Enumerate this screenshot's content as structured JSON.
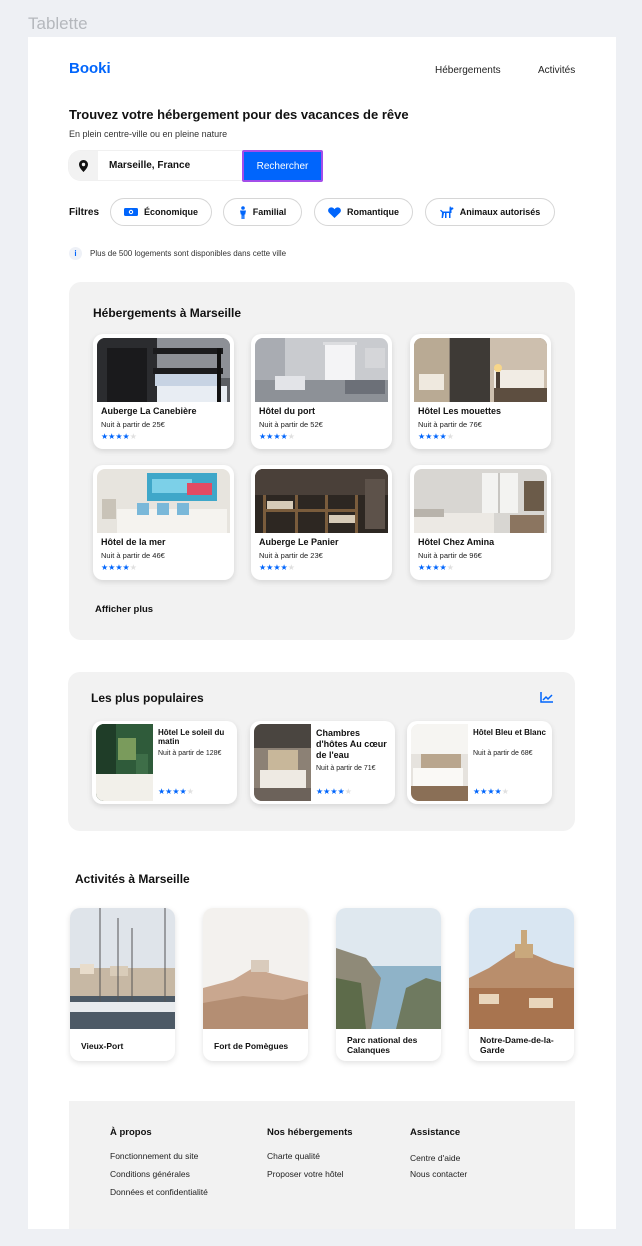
{
  "frame_label": "Tablette",
  "brand": {
    "logo": "Booki",
    "accent": "#0065fc"
  },
  "nav": {
    "items": [
      "Hébergements",
      "Activités"
    ]
  },
  "hero": {
    "title": "Trouvez votre hébergement pour des vacances de rêve",
    "subtitle": "En plein centre-ville ou en pleine nature",
    "search_value": "Marseille, France",
    "search_button": "Rechercher"
  },
  "filters": {
    "label": "Filtres",
    "items": [
      {
        "label": "Économique",
        "icon": "money-icon"
      },
      {
        "label": "Familial",
        "icon": "person-icon"
      },
      {
        "label": "Romantique",
        "icon": "heart-icon"
      },
      {
        "label": "Animaux autorisés",
        "icon": "dog-icon"
      }
    ]
  },
  "info": {
    "icon": "info-icon",
    "text": "Plus de 500 logements sont disponibles dans cette ville"
  },
  "hebergements": {
    "title": "Hébergements à Marseille",
    "more": "Afficher plus",
    "cards": [
      {
        "name": "Auberge La Canebière",
        "price": "Nuit à partir de 25€",
        "rating": 4
      },
      {
        "name": "Hôtel du port",
        "price": "Nuit à partir de 52€",
        "rating": 4
      },
      {
        "name": "Hôtel Les mouettes",
        "price": "Nuit à partir de 76€",
        "rating": 4
      },
      {
        "name": "Hôtel de la mer",
        "price": "Nuit à partir de 46€",
        "rating": 4
      },
      {
        "name": "Auberge Le Panier",
        "price": "Nuit à partir de 23€",
        "rating": 4
      },
      {
        "name": "Hôtel Chez Amina",
        "price": "Nuit à partir de 96€",
        "rating": 4
      }
    ]
  },
  "populaires": {
    "title": "Les plus populaires",
    "icon": "trend-chart-icon",
    "cards": [
      {
        "name": "Hôtel Le soleil du matin",
        "price": "Nuit à partir de 128€",
        "rating": 4
      },
      {
        "name": "Chambres d'hôtes Au cœur de l'eau",
        "price": "Nuit à partir de 71€",
        "rating": 4
      },
      {
        "name": "Hôtel Bleu et Blanc",
        "price": "Nuit à partir de 68€",
        "rating": 4
      }
    ]
  },
  "activites": {
    "title": "Activités à Marseille",
    "cards": [
      {
        "name": "Vieux-Port"
      },
      {
        "name": "Fort de Pomègues"
      },
      {
        "name": "Parc national des Calanques"
      },
      {
        "name": "Notre-Dame-de-la-Garde"
      }
    ]
  },
  "footer": {
    "columns": [
      {
        "title": "À propos",
        "links": [
          "Fonctionnement du site",
          "Conditions générales",
          "Données et confidentialité"
        ]
      },
      {
        "title": "Nos hébergements",
        "links": [
          "Charte qualité",
          "Proposer votre hôtel"
        ]
      },
      {
        "title": "Assistance",
        "links": [
          "Centre d'aide",
          "Nous contacter"
        ]
      }
    ]
  }
}
